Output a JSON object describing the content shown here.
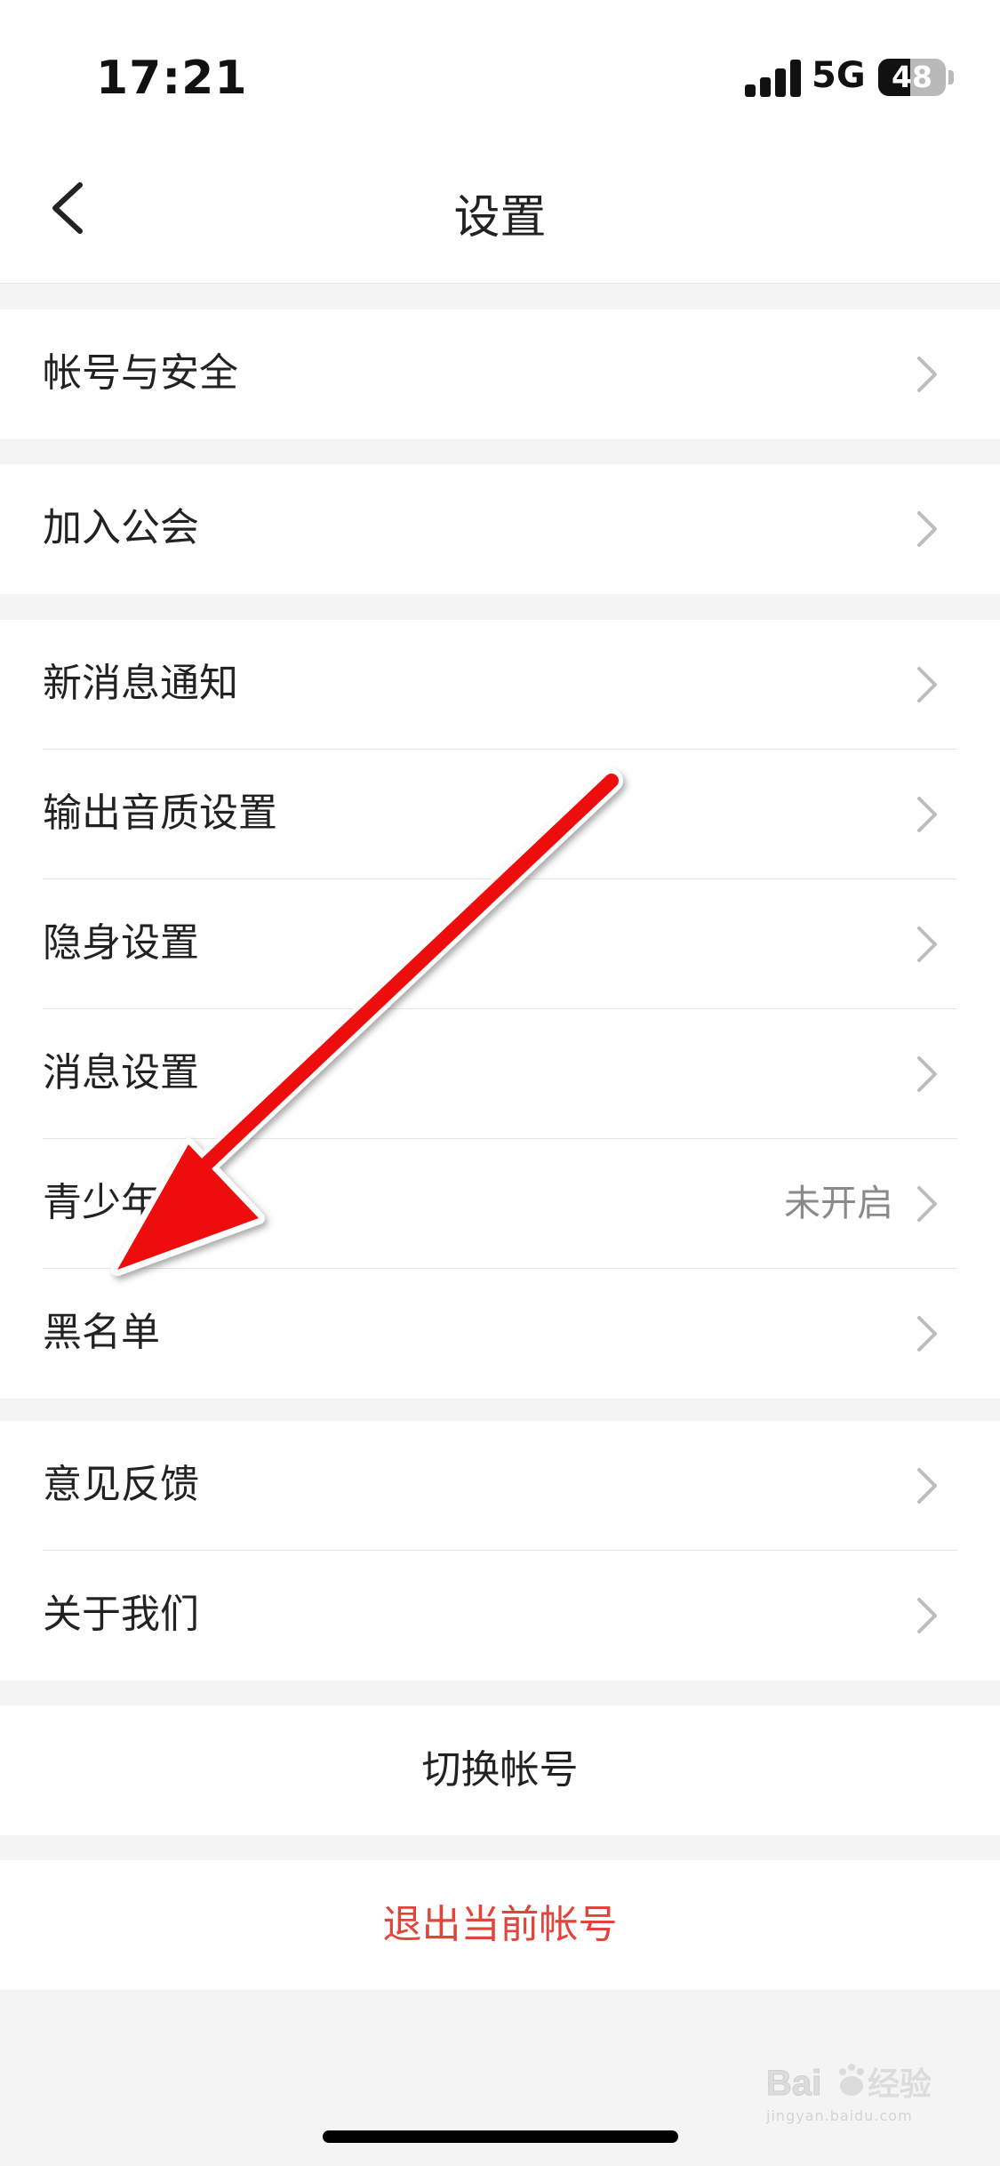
{
  "status_bar": {
    "time": "17:21",
    "network": "5G",
    "battery_level": "48",
    "battery_fraction": 0.48
  },
  "nav": {
    "title": "设置",
    "back_icon": "chevron-left-icon"
  },
  "groups": [
    {
      "items": [
        {
          "label": "帐号与安全"
        }
      ]
    },
    {
      "items": [
        {
          "label": "加入公会"
        }
      ]
    },
    {
      "items": [
        {
          "label": "新消息通知"
        },
        {
          "label": "输出音质设置"
        },
        {
          "label": "隐身设置"
        },
        {
          "label": "消息设置"
        },
        {
          "label": "青少年模式",
          "value": "未开启"
        },
        {
          "label": "黑名单"
        }
      ]
    },
    {
      "items": [
        {
          "label": "意见反馈"
        },
        {
          "label": "关于我们"
        }
      ]
    }
  ],
  "actions": {
    "switch_account": "切换帐号",
    "logout": "退出当前帐号"
  },
  "colors": {
    "background": "#f4f4f4",
    "surface": "#ffffff",
    "text": "#222222",
    "secondary_text": "#8a8a8a",
    "chevron": "#bdbdbd",
    "divider": "#e6e6e6",
    "danger": "#e1443a",
    "annotation_arrow": "#ee1111"
  },
  "annotation": {
    "type": "red-arrow",
    "target": "黑名单"
  },
  "watermark": {
    "brand": "Bai经验",
    "url": "jingyan.baidu.com"
  }
}
